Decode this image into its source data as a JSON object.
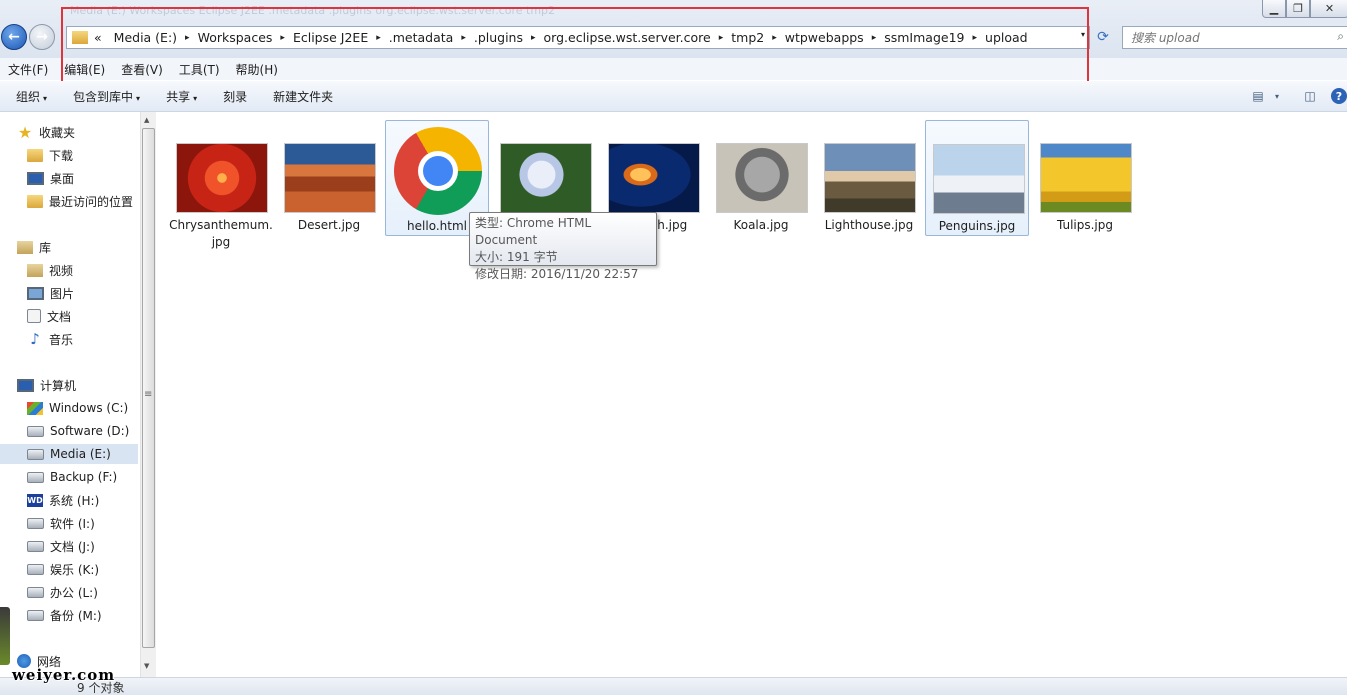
{
  "window": {
    "title_faded": "Media (E:) Workspaces Eclipse J2EE .metadata .plugins org.eclipse.wst.server.core tmp2",
    "minimize": "▁",
    "maximize": "❐",
    "close": "✕"
  },
  "address": {
    "prefix": "«",
    "crumbs": [
      "Media (E:)",
      "Workspaces",
      "Eclipse J2EE",
      ".metadata",
      ".plugins",
      "org.eclipse.wst.server.core",
      "tmp2",
      "wtpwebapps",
      "ssmImage19",
      "upload"
    ],
    "separator": "▸",
    "dropdown": "▾",
    "refresh": "⟳"
  },
  "search": {
    "placeholder": "搜索 upload"
  },
  "menu": [
    "文件(F)",
    "编辑(E)",
    "查看(V)",
    "工具(T)",
    "帮助(H)"
  ],
  "toolbar": {
    "organize": "组织",
    "include_library": "包含到库中",
    "share": "共享",
    "burn": "刻录",
    "new_folder": "新建文件夹",
    "arrow": "▾"
  },
  "sidebar": {
    "favorites": "收藏夹",
    "favorites_items": [
      "下载",
      "桌面",
      "最近访问的位置"
    ],
    "libraries": "库",
    "library_items": [
      "视频",
      "图片",
      "文档",
      "音乐"
    ],
    "computer": "计算机",
    "drives": [
      "Windows (C:)",
      "Software (D:)",
      "Media (E:)",
      "Backup (F:)",
      "系统 (H:)",
      "软件 (I:)",
      "文档 (J:)",
      "娱乐 (K:)",
      "办公 (L:)",
      "备份 (M:)"
    ],
    "selected_drive": "Media (E:)",
    "network": "网络"
  },
  "files": [
    {
      "name": "Chrysanthemum.jpg",
      "kind": "chrysanthemum"
    },
    {
      "name": "Desert.jpg",
      "kind": "desert"
    },
    {
      "name": "hello.html",
      "kind": "chrome"
    },
    {
      "name": "Hydrangeas.jpg",
      "kind": "hydrangeas"
    },
    {
      "name": "Jellyfish.jpg",
      "kind": "jellyfish"
    },
    {
      "name": "Koala.jpg",
      "kind": "koala"
    },
    {
      "name": "Lighthouse.jpg",
      "kind": "lighthouse"
    },
    {
      "name": "Penguins.jpg",
      "kind": "penguins"
    },
    {
      "name": "Tulips.jpg",
      "kind": "tulips"
    }
  ],
  "tooltip": {
    "type": "类型: Chrome HTML Document",
    "size": "大小: 191 字节",
    "modified": "修改日期: 2016/11/20 22:57"
  },
  "status": {
    "count": "9 个对象"
  },
  "watermark": "weiyer.com",
  "colors": {
    "highlight_box": "#e0343c",
    "selection": "#d9e4f3"
  }
}
